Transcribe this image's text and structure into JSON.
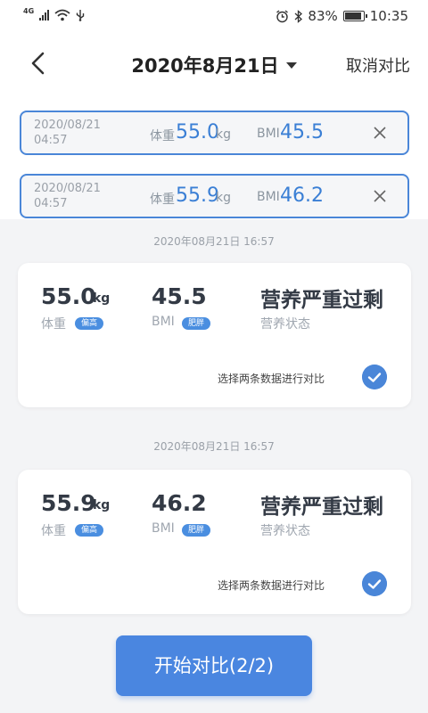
{
  "status_bar": {
    "network": "4G",
    "battery": "83%",
    "battery_level": 0.83,
    "time": "10:35"
  },
  "header": {
    "date_title": "2020年8月21日",
    "cancel_label": "取消对比"
  },
  "compare_items": [
    {
      "date": "2020/08/21",
      "time": "04:57",
      "weight_label": "体重",
      "weight": "55.0",
      "weight_unit": "kg",
      "bmi_label": "BMI",
      "bmi": "45.5"
    },
    {
      "date": "2020/08/21",
      "time": "04:57",
      "weight_label": "体重",
      "weight": "55.9",
      "weight_unit": "kg",
      "bmi_label": "BMI",
      "bmi": "46.2"
    }
  ],
  "records": [
    {
      "timestamp": "2020年08月21日 16:57",
      "weight": "55.0",
      "weight_unit": "kg",
      "weight_label": "体重",
      "weight_tag": "偏高",
      "bmi": "45.5",
      "bmi_label": "BMI",
      "bmi_tag": "肥胖",
      "nutrition": "营养严重过剩",
      "nutrition_label": "营养状态",
      "select_hint": "选择两条数据进行对比"
    },
    {
      "timestamp": "2020年08月21日 16:57",
      "weight": "55.9",
      "weight_unit": "kg",
      "weight_label": "体重",
      "weight_tag": "偏高",
      "bmi": "46.2",
      "bmi_label": "BMI",
      "bmi_tag": "肥胖",
      "nutrition": "营养严重过剩",
      "nutrition_label": "营养状态",
      "select_hint": "选择两条数据进行对比"
    }
  ],
  "start_button": "开始对比(2/2)",
  "colors": {
    "accent": "#4a86e0",
    "value_blue": "#3a7fd5",
    "background": "#f3f4f6"
  }
}
